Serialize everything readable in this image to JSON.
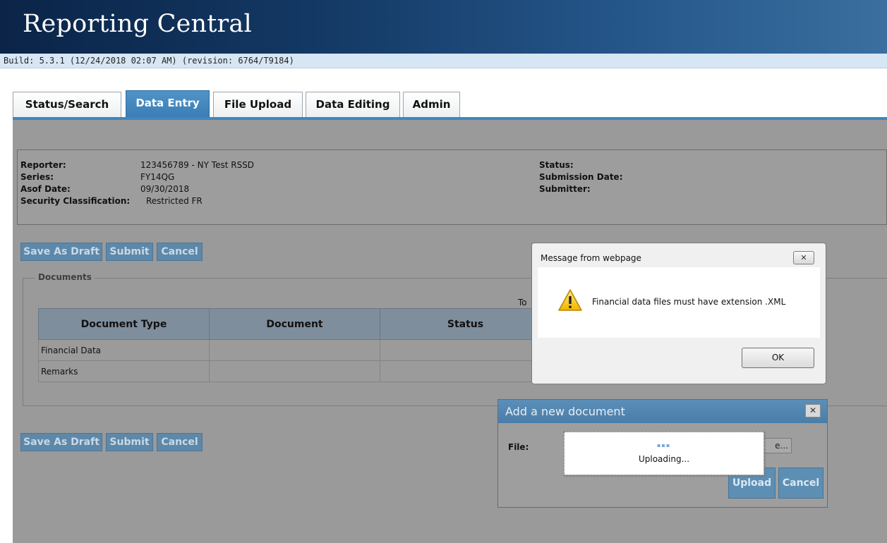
{
  "header": {
    "title": "Reporting Central",
    "build": "Build: 5.3.1 (12/24/2018 02:07 AM) (revision: 6764/T9184)"
  },
  "tabs": [
    {
      "label": "Status/Search"
    },
    {
      "label": "Data Entry"
    },
    {
      "label": "File Upload"
    },
    {
      "label": "Data Editing"
    },
    {
      "label": "Admin"
    }
  ],
  "active_tab": "Data Entry",
  "info": {
    "reporter_label": "Reporter:",
    "reporter_value": "123456789 - NY Test RSSD",
    "series_label": "Series:",
    "series_value": "FY14QG",
    "asof_label": "Asof Date:",
    "asof_value": "09/30/2018",
    "security_label": "Security Classification:",
    "security_value": "Restricted FR",
    "status_label": "Status:",
    "submission_date_label": "Submission Date:",
    "submitter_label": "Submitter:"
  },
  "actions": {
    "save_draft": "Save As Draft",
    "submit": "Submit",
    "cancel": "Cancel"
  },
  "documents": {
    "legend": "Documents",
    "partial_text": "To",
    "columns": [
      "Document Type",
      "Document",
      "Status"
    ],
    "rows": [
      {
        "type": "Financial Data",
        "document": "",
        "status": ""
      },
      {
        "type": "Remarks",
        "document": "",
        "status": ""
      }
    ]
  },
  "message_dialog": {
    "title": "Message from webpage",
    "close": "✕",
    "text": "Financial data files must have extension .XML",
    "ok": "OK",
    "icon": "warning-icon"
  },
  "add_document_dialog": {
    "title": "Add a new document",
    "close": "✕",
    "file_label": "File:",
    "browse_partial": "e...",
    "upload": "Upload",
    "cancel": "Cancel"
  },
  "uploading": {
    "text": "Uploading..."
  },
  "colors": {
    "tab_active": "#3a7db4",
    "banner_dark": "#0b2448",
    "overlay": "#9a9a9a",
    "action_button": "#5d88a9"
  }
}
